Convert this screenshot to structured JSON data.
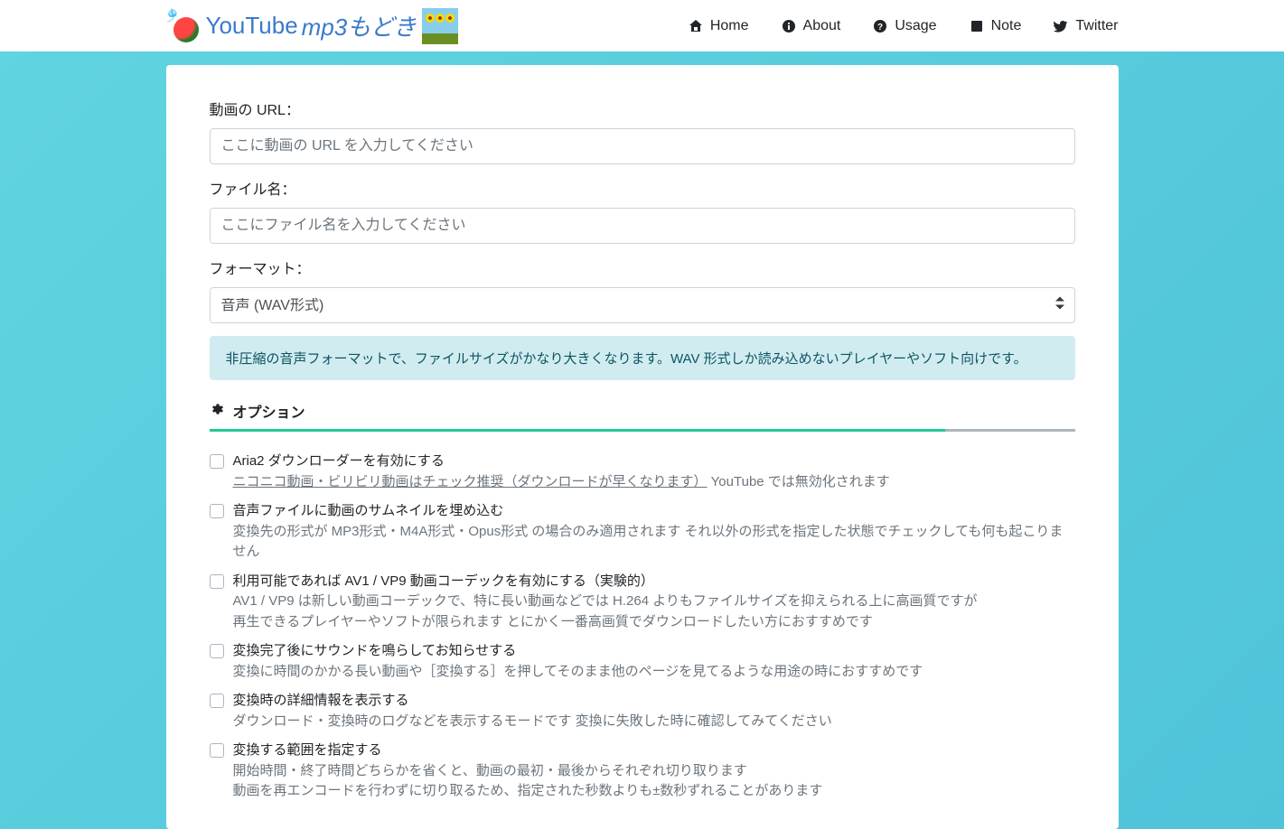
{
  "logo": {
    "text1": "YouTube",
    "text2": "mp3もどき"
  },
  "nav": [
    {
      "icon": "home",
      "label": "Home"
    },
    {
      "icon": "info",
      "label": "About"
    },
    {
      "icon": "question",
      "label": "Usage"
    },
    {
      "icon": "note",
      "label": "Note"
    },
    {
      "icon": "twitter",
      "label": "Twitter"
    }
  ],
  "form": {
    "url_label": "動画の URL：",
    "url_placeholder": "ここに動画の URL を入力してください",
    "filename_label": "ファイル名：",
    "filename_placeholder": "ここにファイル名を入力してください",
    "format_label": "フォーマット：",
    "format_value": "音声 (WAV形式)"
  },
  "info_text": "非圧縮の音声フォーマットで、ファイルサイズがかなり大きくなります。WAV 形式しか読み込めないプレイヤーやソフト向けです。",
  "options": {
    "header": "オプション",
    "items": [
      {
        "title": "Aria2 ダウンローダーを有効にする",
        "desc_underline": "ニコニコ動画・ビリビリ動画はチェック推奨（ダウンロードが早くなります）",
        "desc_rest": " YouTube では無効化されます"
      },
      {
        "title": "音声ファイルに動画のサムネイルを埋め込む",
        "desc": "変換先の形式が MP3形式・M4A形式・Opus形式 の場合のみ適用されます それ以外の形式を指定した状態でチェックしても何も起こりません"
      },
      {
        "title": "利用可能であれば AV1 / VP9 動画コーデックを有効にする（実験的）",
        "desc": "AV1 / VP9 は新しい動画コーデックで、特に長い動画などでは H.264 よりもファイルサイズを抑えられる上に高画質ですが\n再生できるプレイヤーやソフトが限られます とにかく一番高画質でダウンロードしたい方におすすめです"
      },
      {
        "title": "変換完了後にサウンドを鳴らしてお知らせする",
        "desc": "変換に時間のかかる長い動画や［変換する］を押してそのまま他のページを見てるような用途の時におすすめです"
      },
      {
        "title": "変換時の詳細情報を表示する",
        "desc": "ダウンロード・変換時のログなどを表示するモードです 変換に失敗した時に確認してみてください"
      },
      {
        "title": "変換する範囲を指定する",
        "desc": "開始時間・終了時間どちらかを省くと、動画の最初・最後からそれぞれ切り取ります\n動画を再エンコードを行わずに切り取るため、指定された秒数よりも±数秒ずれることがあります"
      }
    ]
  }
}
